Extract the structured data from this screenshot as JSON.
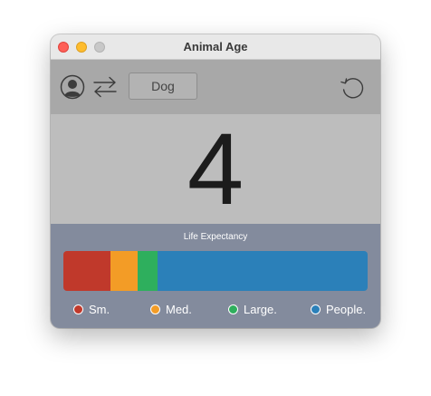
{
  "window": {
    "title": "Animal Age"
  },
  "toolbar": {
    "animal_label": "Dog",
    "icons": [
      "person-icon",
      "swap-arrows-icon",
      "reset-icon"
    ]
  },
  "age": {
    "value": "4"
  },
  "life_expectancy": {
    "title": "Life Expectancy",
    "segments": [
      {
        "name": "Sm.",
        "fraction": 0.155,
        "color": "#c0392b"
      },
      {
        "name": "Med.",
        "fraction": 0.088,
        "color": "#f39c26"
      },
      {
        "name": "Large.",
        "fraction": 0.068,
        "color": "#2eaf5d"
      },
      {
        "name": "People.",
        "fraction": 0.689,
        "color": "#2b80b9"
      }
    ]
  },
  "legend": {
    "items": [
      {
        "label": "Sm.",
        "color": "#c0392b"
      },
      {
        "label": "Med.",
        "color": "#f39c26"
      },
      {
        "label": "Large.",
        "color": "#2eaf5d"
      },
      {
        "label": "People.",
        "color": "#2b80b9"
      }
    ]
  }
}
